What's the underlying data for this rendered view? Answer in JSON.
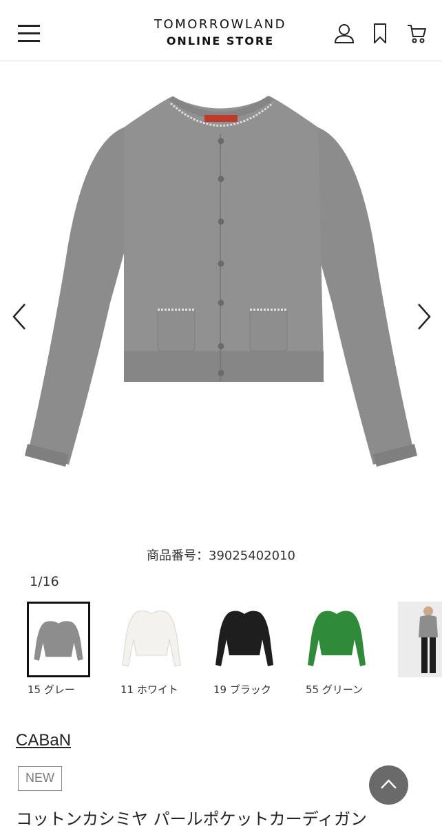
{
  "header": {
    "logo_line1": "TOMORROWLAND",
    "logo_line2": "ONLINE STORE",
    "icons": [
      "menu-icon",
      "account-icon",
      "bookmark-icon",
      "cart-icon"
    ]
  },
  "product": {
    "code_text": "商品番号：39025402010",
    "image_counter": "1/16",
    "brand": "CABaN",
    "badge": "NEW",
    "title": "コットンカシミヤ パールポケットカーディガン"
  },
  "colors": [
    {
      "label": "15 グレー",
      "swatch": "#8d8d8d",
      "selected": true
    },
    {
      "label": "11 ホワイト",
      "swatch": "#f4f2ee",
      "selected": false
    },
    {
      "label": "19 ブラック",
      "swatch": "#1e1e1e",
      "selected": false
    },
    {
      "label": "55 グリーン",
      "swatch": "#2f8a3a",
      "selected": false
    }
  ],
  "theme": {
    "text": "#222222",
    "divider": "#dcdcdc",
    "scroll_top_button": "#6a6a6a"
  }
}
